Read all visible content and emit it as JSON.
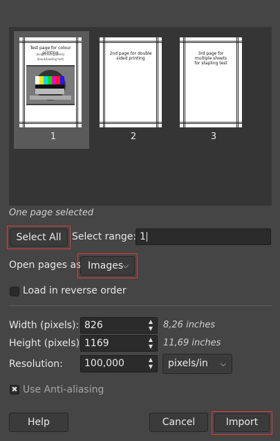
{
  "pages": [
    {
      "number": "1",
      "title": "Test page for colour printing",
      "sub1": "(brightness/gamma)",
      "sub2": "(blank/loading test)"
    },
    {
      "number": "2",
      "text": "2nd page for double sided printing"
    },
    {
      "number": "3",
      "text": "3rd page for multiple sheets for stapling test"
    }
  ],
  "selection_status": "One page selected",
  "select_all_label": "Select All",
  "select_range_label": "Select range:",
  "select_range_value": "1",
  "open_pages_as_label": "Open pages as",
  "open_pages_as_value": "Images",
  "reverse_order_label": "Load in reverse order",
  "width_label": "Width (pixels):",
  "width_value": "826",
  "width_inches": "8,26 inches",
  "height_label": "Height (pixels):",
  "height_value": "1169",
  "height_inches": "11,69 inches",
  "resolution_label": "Resolution:",
  "resolution_value": "100,000",
  "resolution_unit": "pixels/in",
  "antialias_label": "Use Anti-aliasing",
  "help_label": "Help",
  "cancel_label": "Cancel",
  "import_label": "Import",
  "colors": {
    "highlight": "#e53935",
    "background": "#454545",
    "panel": "#353535"
  }
}
